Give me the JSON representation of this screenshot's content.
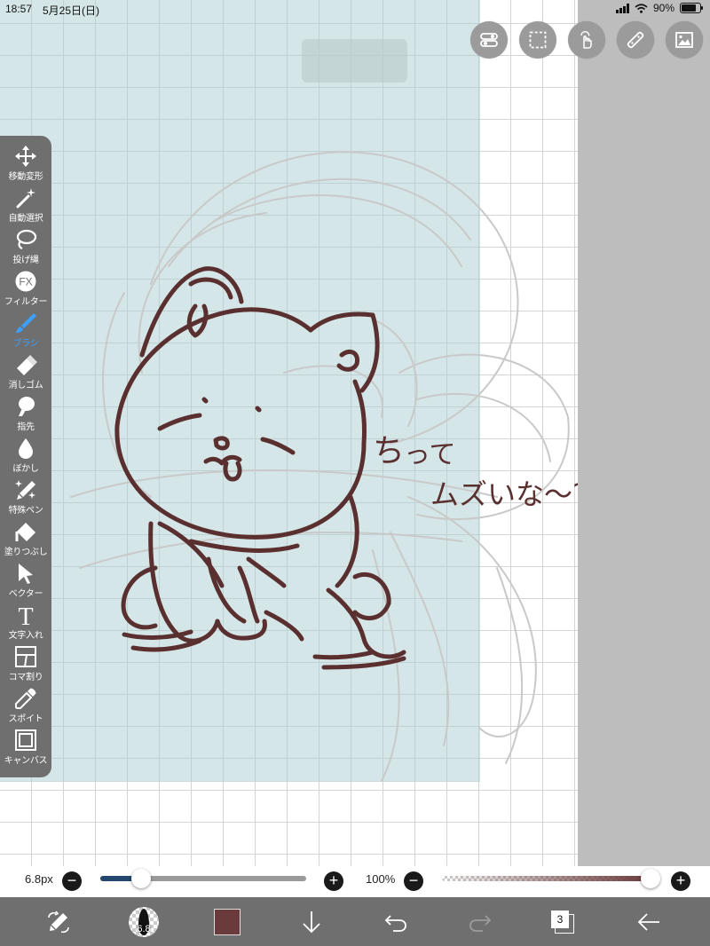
{
  "status_bar": {
    "time": "18:57",
    "date": "5月25日(日)",
    "battery": "90%",
    "battery_level": 0.9
  },
  "canvas": {
    "handwritten_text": [
      "ち",
      "って",
      "ムズいな〜?"
    ],
    "line_color": "#5a2f2f",
    "panel_color": "#b9d6d8"
  },
  "top_buttons": [
    {
      "name": "toggle-icon"
    },
    {
      "name": "selection-icon"
    },
    {
      "name": "touch-icon"
    },
    {
      "name": "ruler-icon"
    },
    {
      "name": "image-icon"
    }
  ],
  "left_toolbar": {
    "tools": [
      {
        "label": "移動変形",
        "icon": "move-icon"
      },
      {
        "label": "自動選択",
        "icon": "magic-wand-icon"
      },
      {
        "label": "投げ縄",
        "icon": "lasso-icon"
      },
      {
        "label": "フィルター",
        "icon": "fx-icon",
        "icon_text": "FX"
      },
      {
        "label": "ブラシ",
        "icon": "brush-icon",
        "active": true
      },
      {
        "label": "消しゴム",
        "icon": "eraser-icon"
      },
      {
        "label": "指先",
        "icon": "finger-icon"
      },
      {
        "label": "ぼかし",
        "icon": "blur-icon"
      },
      {
        "label": "特殊ペン",
        "icon": "special-pen-icon"
      },
      {
        "label": "塗りつぶし",
        "icon": "fill-icon"
      },
      {
        "label": "ベクター",
        "icon": "vector-icon"
      },
      {
        "label": "文字入れ",
        "icon": "text-icon",
        "icon_text": "T"
      },
      {
        "label": "コマ割り",
        "icon": "frame-divider-icon"
      },
      {
        "label": "スポイト",
        "icon": "eyedropper-icon"
      },
      {
        "label": "キャンバス",
        "icon": "canvas-icon"
      }
    ]
  },
  "slider_bar": {
    "size_label": "6.8px",
    "size_fraction": 0.2,
    "opacity_label": "100%",
    "opacity_fraction": 1.0,
    "minus": "−",
    "plus": "+"
  },
  "bottom_bar": {
    "brush_size": "6.8",
    "color": "#6b3a3a",
    "layer_count": "3"
  }
}
